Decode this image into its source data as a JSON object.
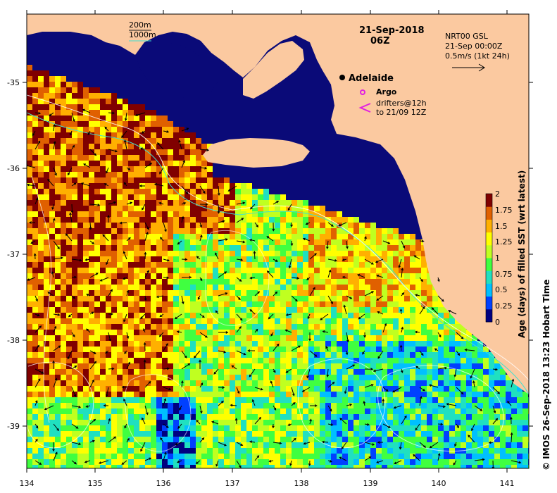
{
  "title": {
    "date": "21-Sep-2018",
    "time": "06Z"
  },
  "depth_legend": {
    "shallow": "200m",
    "deep": "1000m",
    "shallow_color": "#1a1a1a",
    "deep_color": "#40e0d0"
  },
  "current_legend": {
    "line1": "NRT00 GSL",
    "line2": "21-Sep 00:00Z",
    "line3": "0.5m/s (1kt 24h)"
  },
  "places": {
    "city": "Adelaide"
  },
  "markers_legend": {
    "argo": "Argo",
    "argo_color": "#e020e0",
    "drifters_line1": "drifters@12h",
    "drifters_line2": "to 21/09 12Z",
    "drifters_color": "#e020e0"
  },
  "colors": {
    "land": "#fbc9a0",
    "deep_water": "#0a0a78"
  },
  "axes": {
    "x_ticks": [
      "134",
      "135",
      "136",
      "137",
      "138",
      "139",
      "140",
      "141"
    ],
    "y_ticks": [
      "-35",
      "-36",
      "-37",
      "-38",
      "-39"
    ]
  },
  "colorbar": {
    "title": "Age (days) of filled SST (wrt latest)",
    "labels": [
      "0",
      "0.25",
      "0.5",
      "0.75",
      "1",
      "1.25",
      "1.5",
      "1.75",
      "2"
    ],
    "colors": [
      "#000080",
      "#0040ff",
      "#00c0ff",
      "#20e0c0",
      "#40ff40",
      "#c0ff20",
      "#ffff00",
      "#ffb000",
      "#e06000",
      "#800000"
    ]
  },
  "credit": "© IMOS 26-Sep-2018 13:23 Hobart Time"
}
